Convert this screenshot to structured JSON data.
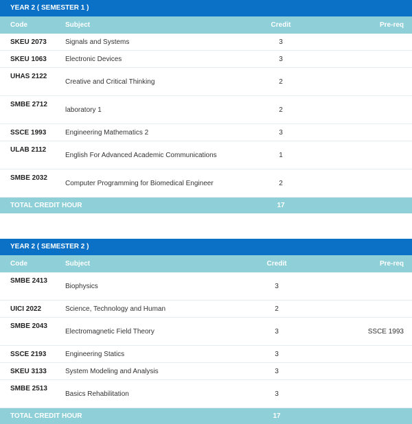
{
  "columns": {
    "code": "Code",
    "subject": "Subject",
    "credit": "Credit",
    "prereq": "Pre-req"
  },
  "sem1": {
    "title": "YEAR 2 ( SEMESTER 1 )",
    "rows": [
      {
        "code": "SKEU 2073",
        "subject": "Signals and Systems",
        "credit": "3",
        "prereq": ""
      },
      {
        "code": "SKEU 1063",
        "subject": "Electronic Devices",
        "credit": "3",
        "prereq": ""
      },
      {
        "code": "UHAS 2122",
        "subject": "Creative and Critical Thinking",
        "credit": "2",
        "prereq": ""
      },
      {
        "code": "SMBE 2712",
        "subject": "laboratory 1",
        "credit": "2",
        "prereq": ""
      },
      {
        "code": "SSCE 1993",
        "subject": "Engineering Mathematics 2",
        "credit": "3",
        "prereq": ""
      },
      {
        "code": "ULAB 2112",
        "subject": "English For Advanced Academic Communications",
        "credit": "1",
        "prereq": ""
      },
      {
        "code": "SMBE 2032",
        "subject": "Computer Programming for Biomedical Engineer",
        "credit": "2",
        "prereq": ""
      }
    ],
    "total_label": "TOTAL CREDIT HOUR",
    "total_value": "17"
  },
  "sem2": {
    "title": "YEAR 2 ( SEMESTER 2 )",
    "rows": [
      {
        "code": "SMBE 2413",
        "subject": "Biophysics",
        "credit": "3",
        "prereq": ""
      },
      {
        "code": "UICI 2022",
        "subject": "Science, Technology and Human",
        "credit": "2",
        "prereq": ""
      },
      {
        "code": "SMBE 2043",
        "subject": "Electromagnetic Field Theory",
        "credit": "3",
        "prereq": "SSCE 1993"
      },
      {
        "code": "SSCE 2193",
        "subject": "Engineering Statics",
        "credit": "3",
        "prereq": ""
      },
      {
        "code": "SKEU 3133",
        "subject": "System Modeling and Analysis",
        "credit": "3",
        "prereq": ""
      },
      {
        "code": "SMBE 2513",
        "subject": "Basics Rehabilitation",
        "credit": "3",
        "prereq": ""
      }
    ],
    "total_label": "TOTAL CREDIT HOUR",
    "total_value": "17"
  }
}
